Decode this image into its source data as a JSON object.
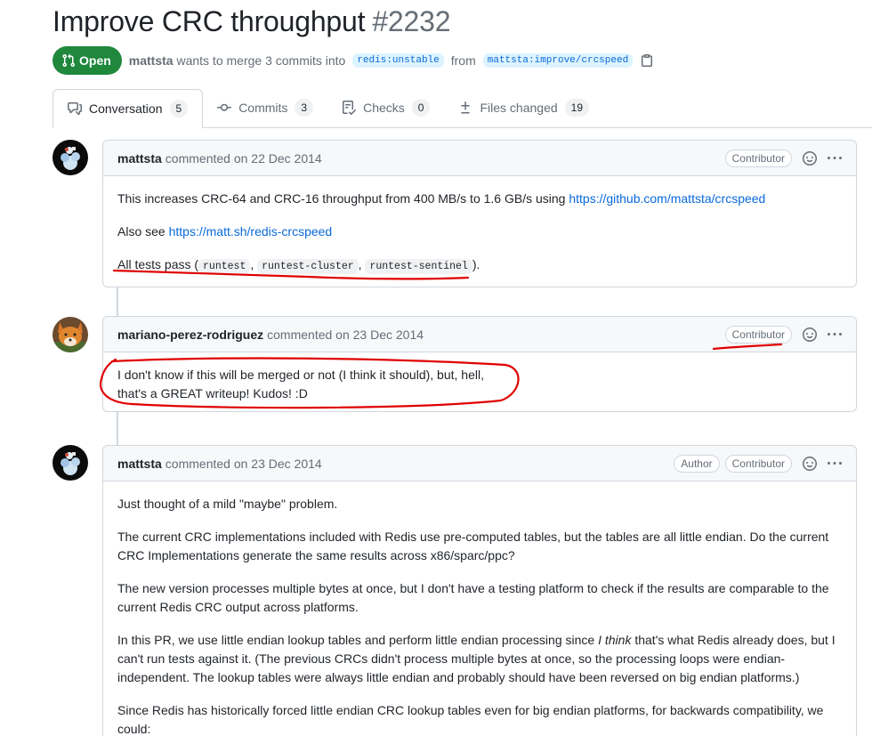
{
  "pr": {
    "title": "Improve CRC throughput",
    "number": "#2232",
    "state": "Open",
    "author": "mattsta",
    "merge_text": "wants to merge 3 commits into",
    "base_branch": "redis:unstable",
    "from_text": "from",
    "head_branch": "mattsta:improve/crcspeed"
  },
  "tabs": [
    {
      "label": "Conversation",
      "count": "5",
      "icon": "comment-discussion-icon"
    },
    {
      "label": "Commits",
      "count": "3",
      "icon": "git-commit-icon"
    },
    {
      "label": "Checks",
      "count": "0",
      "icon": "checklist-icon"
    },
    {
      "label": "Files changed",
      "count": "19",
      "icon": "file-diff-icon"
    }
  ],
  "comments": [
    {
      "author": "mattsta",
      "meta": "commented on 22 Dec 2014",
      "badges": [
        "Contributor"
      ],
      "p1_text": "This increases CRC-64 and CRC-16 throughput from 400 MB/s to 1.6 GB/s using ",
      "p1_link": "https://github.com/mattsta/crcspeed",
      "p2_text": "Also see ",
      "p2_link": "https://matt.sh/redis-crcspeed",
      "p3_pre": "All tests pass (",
      "p3_code1": "runtest",
      "p3_sep1": ",",
      "p3_code2": "runtest-cluster",
      "p3_sep2": ",",
      "p3_code3": "runtest-sentinel",
      "p3_post": ")."
    },
    {
      "author": "mariano-perez-rodriguez",
      "meta": "commented on 23 Dec 2014",
      "badges": [
        "Contributor"
      ],
      "line1": "I don't know if this will be merged or not (I think it should), but, hell,",
      "line2": "that's a GREAT writeup! Kudos! :D"
    },
    {
      "author": "mattsta",
      "meta": "commented on 23 Dec 2014",
      "badges": [
        "Author",
        "Contributor"
      ],
      "p1": "Just thought of a mild \"maybe\" problem.",
      "p2": "The current CRC implementations included with Redis use pre-computed tables, but the tables are all little endian. Do the current CRC Implementations generate the same results across x86/sparc/ppc?",
      "p3": "The new version processes multiple bytes at once, but I don't have a testing platform to check if the results are comparable to the current Redis CRC output across platforms.",
      "p4_pre": "In this PR, we use little endian lookup tables and perform little endian processing since ",
      "p4_em": "I think",
      "p4_post": " that's what Redis already does, but I can't run tests against it. (The previous CRCs didn't process multiple bytes at once, so the processing loops were endian-independent. The lookup tables were always little endian and probably should have been reversed on big endian platforms.)",
      "p5": "Since Redis has historically forced little endian CRC lookup tables even for big endian platforms, for backwards compatibility, we could:"
    }
  ],
  "colors": {
    "open_green": "#1f883d",
    "link_blue": "#0969da",
    "annotation_red": "#e00000"
  }
}
